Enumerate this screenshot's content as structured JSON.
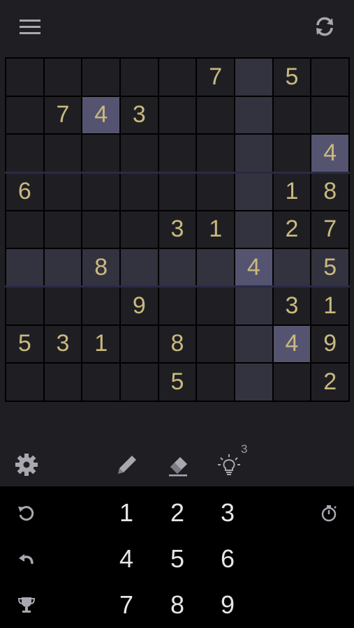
{
  "topbar": {
    "menu_icon": "hamburger-menu-icon",
    "refresh_icon": "refresh-icon"
  },
  "board": {
    "cells": [
      [
        "",
        "",
        "",
        "",
        "",
        "7",
        "",
        "5",
        ""
      ],
      [
        "",
        "7",
        "4",
        "3",
        "",
        "",
        "",
        "",
        ""
      ],
      [
        "",
        "",
        "",
        "",
        "",
        "",
        "",
        "",
        "4"
      ],
      [
        "6",
        "",
        "",
        "",
        "",
        "",
        "",
        "1",
        "8"
      ],
      [
        "",
        "",
        "",
        "",
        "3",
        "1",
        "",
        "2",
        "7"
      ],
      [
        "",
        "",
        "8",
        "",
        "",
        "",
        "4",
        "",
        "5"
      ],
      [
        "",
        "",
        "",
        "9",
        "",
        "",
        "",
        "3",
        "1"
      ],
      [
        "5",
        "3",
        "1",
        "",
        "8",
        "",
        "",
        "4",
        "9"
      ],
      [
        "",
        "",
        "",
        "",
        "5",
        "",
        "",
        "",
        "2"
      ]
    ],
    "selected": {
      "row": 5,
      "col": 6
    },
    "same_value": "4",
    "colors": {
      "digit": "#c9b97f",
      "cell": "#1f1f23",
      "highlight": "#33323f",
      "same_value": "#555470",
      "grid_line": "#000000"
    }
  },
  "tools": {
    "settings_icon": "gear-icon",
    "pencil_icon": "pencil-icon",
    "eraser_icon": "eraser-icon",
    "hint_icon": "lightbulb-icon",
    "hint_count": "3"
  },
  "keypad": {
    "numbers": [
      "1",
      "2",
      "3",
      "4",
      "5",
      "6",
      "7",
      "8",
      "9"
    ],
    "left_icons": [
      "restart-icon",
      "undo-icon",
      "trophy-icon"
    ],
    "right_icon": "stopwatch-icon"
  }
}
